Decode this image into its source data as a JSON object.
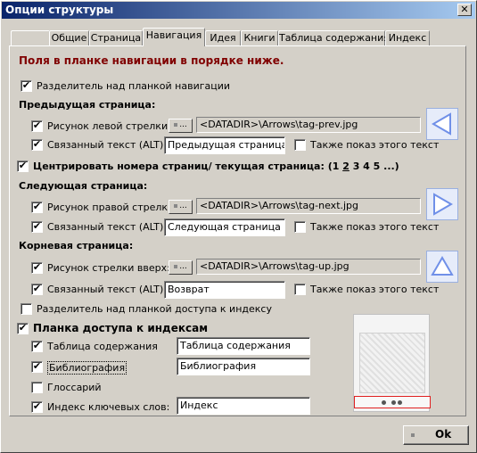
{
  "window": {
    "title": "Опции структуры",
    "close_glyph": "✕"
  },
  "tabs": [
    {
      "label": ""
    },
    {
      "label": "Общие"
    },
    {
      "label": "Страница"
    },
    {
      "label": "Навигация",
      "active": true
    },
    {
      "label": "Идея"
    },
    {
      "label": "Книги"
    },
    {
      "label": "Таблица содержания"
    },
    {
      "label": "Индекс"
    }
  ],
  "nav": {
    "heading": "Поля в планке навигации в порядке ниже.",
    "separator_top": {
      "label": "Разделитель над планкой навигации",
      "checked": true
    },
    "prev": {
      "section": "Предыдущая страница:",
      "image_label": "Рисунок левой стрелки:",
      "image_checked": true,
      "browse": "...",
      "path": "<DATADIR>\\Arrows\\tag-prev.jpg",
      "alt_label": "Связанный текст (ALT) :",
      "alt_checked": true,
      "alt_value": "Предыдущая страница",
      "also_label": "Также показ этого текст",
      "also_checked": false
    },
    "center": {
      "label_main": "Центрировать номера страниц/ текущая страница: (1 ",
      "current": "2",
      "label_rest": " 3 4 5 ...)",
      "checked": true
    },
    "next": {
      "section": "Следующая страница:",
      "image_label": "Рисунок правой стрелки:",
      "image_checked": true,
      "browse": "...",
      "path": "<DATADIR>\\Arrows\\tag-next.jpg",
      "alt_label": "Связанный текст (ALT) :",
      "alt_checked": true,
      "alt_value": "Следующая страница",
      "also_label": "Также показ этого текст",
      "also_checked": false
    },
    "root": {
      "section": "Корневая страница:",
      "image_label": "Рисунок стрелки вверх:",
      "image_checked": true,
      "browse": "...",
      "path": "<DATADIR>\\Arrows\\tag-up.jpg",
      "alt_label": "Связанный текст (ALT) :",
      "alt_checked": true,
      "alt_value": "Возврат",
      "also_label": "Также показ этого текст",
      "also_checked": false
    },
    "separator_index": {
      "label": "Разделитель над планкой доступа к индексу",
      "checked": false
    },
    "index_bar": {
      "label": "Планка доступа к индексам",
      "checked": true,
      "items": [
        {
          "label": "Таблица содержания",
          "checked": true,
          "value": "Таблица содержания"
        },
        {
          "label": "Библиография",
          "checked": true,
          "value": "Библиография"
        },
        {
          "label": "Глоссарий",
          "checked": false,
          "value": null
        },
        {
          "label": "Индекс ключевых слов:",
          "checked": true,
          "value": "Индекс"
        }
      ]
    }
  },
  "footer": {
    "ok_label": "Ok"
  },
  "check_glyph": "✔",
  "colors": {
    "heading": "#800000",
    "arrow": "#7090e8",
    "titlebar": "#0a246a"
  }
}
